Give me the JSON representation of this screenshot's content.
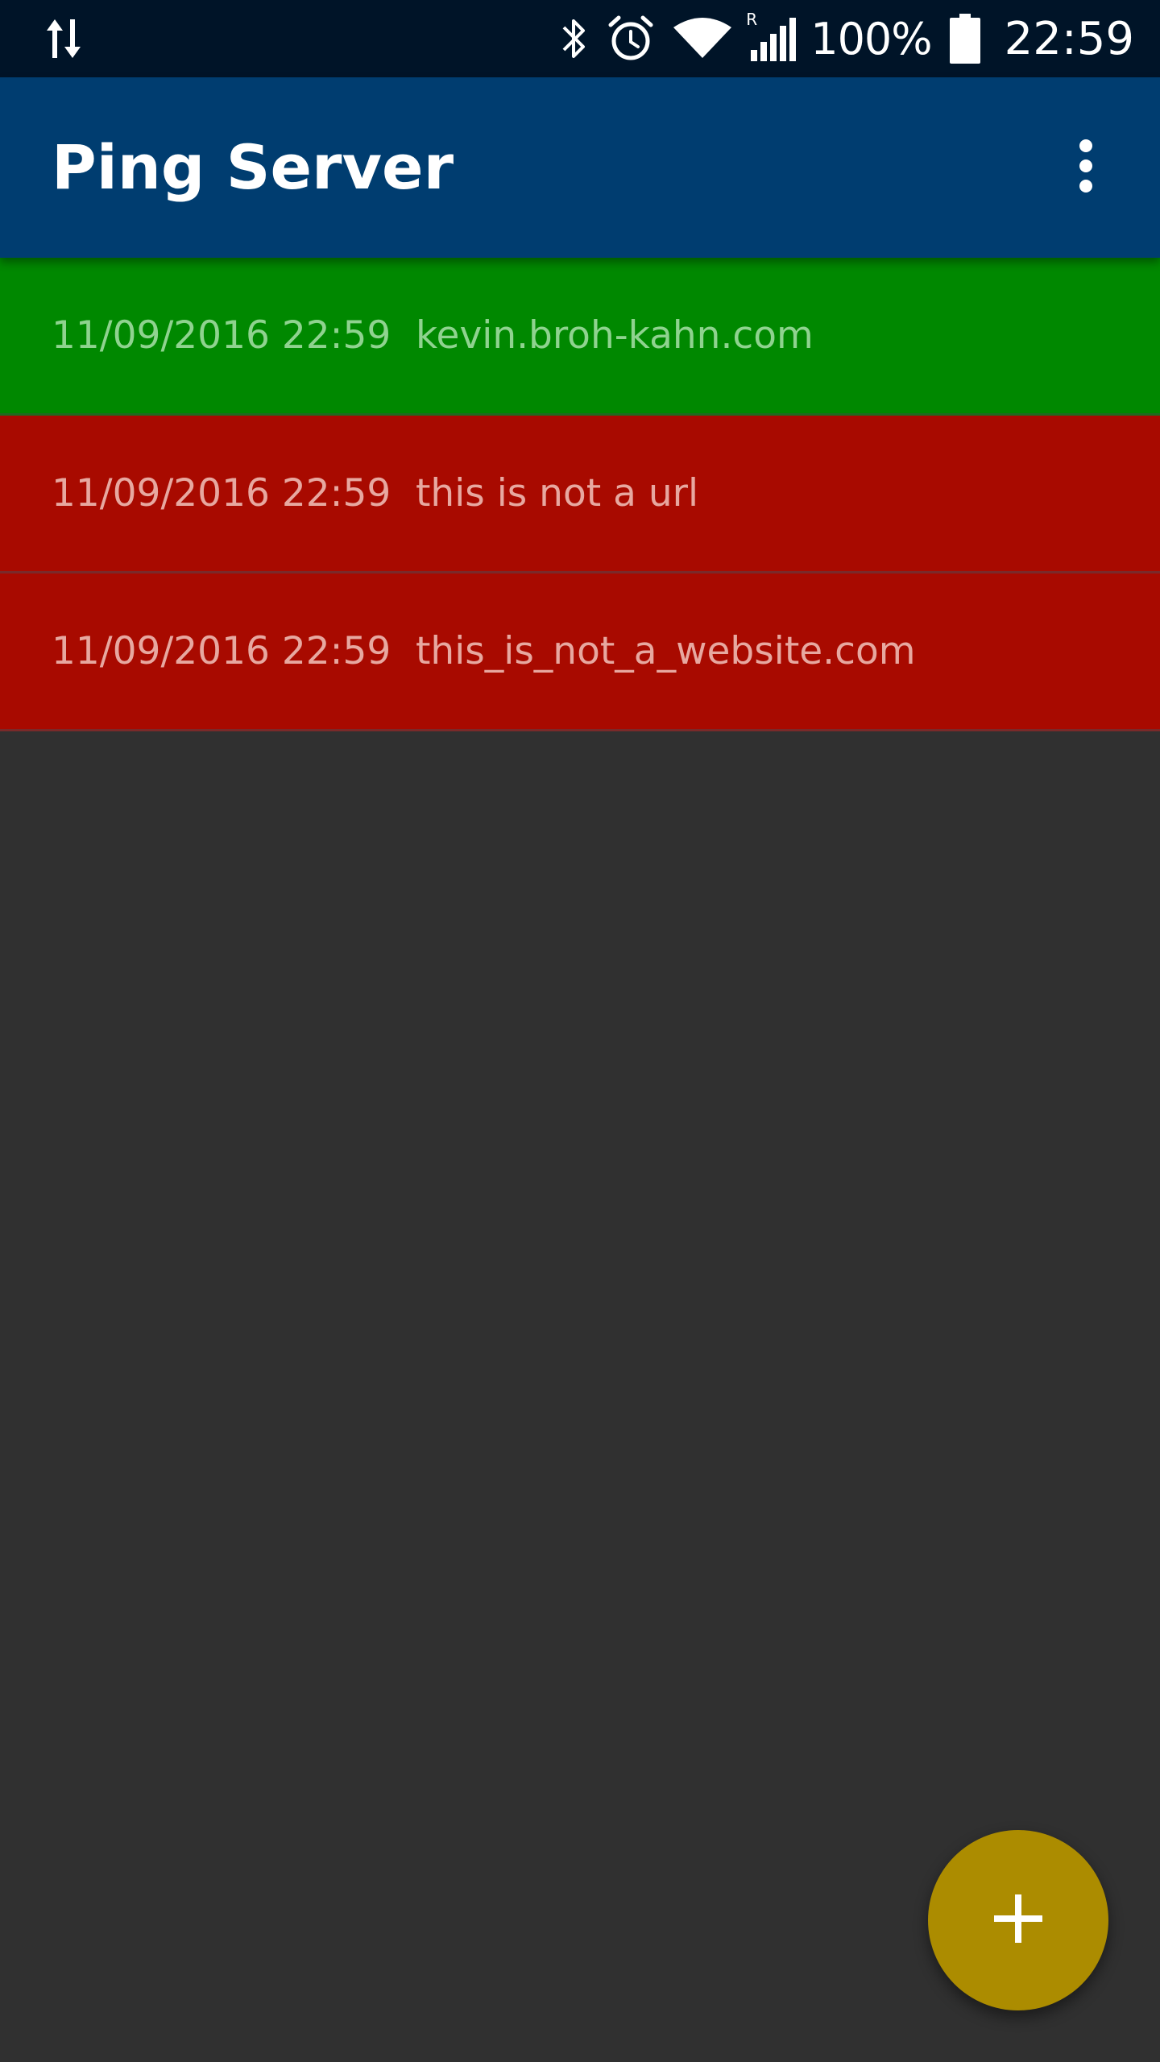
{
  "status_bar": {
    "battery_percent": "100%",
    "time": "22:59",
    "icons": [
      "data-transfer-icon",
      "bluetooth-icon",
      "alarm-icon",
      "wifi-icon",
      "roaming-indicator",
      "cell-signal-icon",
      "battery-icon"
    ],
    "roaming_label": "R"
  },
  "app_bar": {
    "title": "Ping Server",
    "menu_icon": "more-vert-icon"
  },
  "pings": [
    {
      "timestamp": "11/09/2016 22:59",
      "host": "kevin.broh-kahn.com",
      "status": "success"
    },
    {
      "timestamp": "11/09/2016 22:59",
      "host": "this is not a url",
      "status": "failure"
    },
    {
      "timestamp": "11/09/2016 22:59",
      "host": "this_is_not_a_website.com",
      "status": "failure"
    }
  ],
  "fab": {
    "icon": "add-icon"
  },
  "colors": {
    "status_bar": "#001428",
    "app_bar": "#003d70",
    "background": "#303030",
    "success": "#008800",
    "failure": "#a80a00",
    "fab": "#ac8c00"
  }
}
